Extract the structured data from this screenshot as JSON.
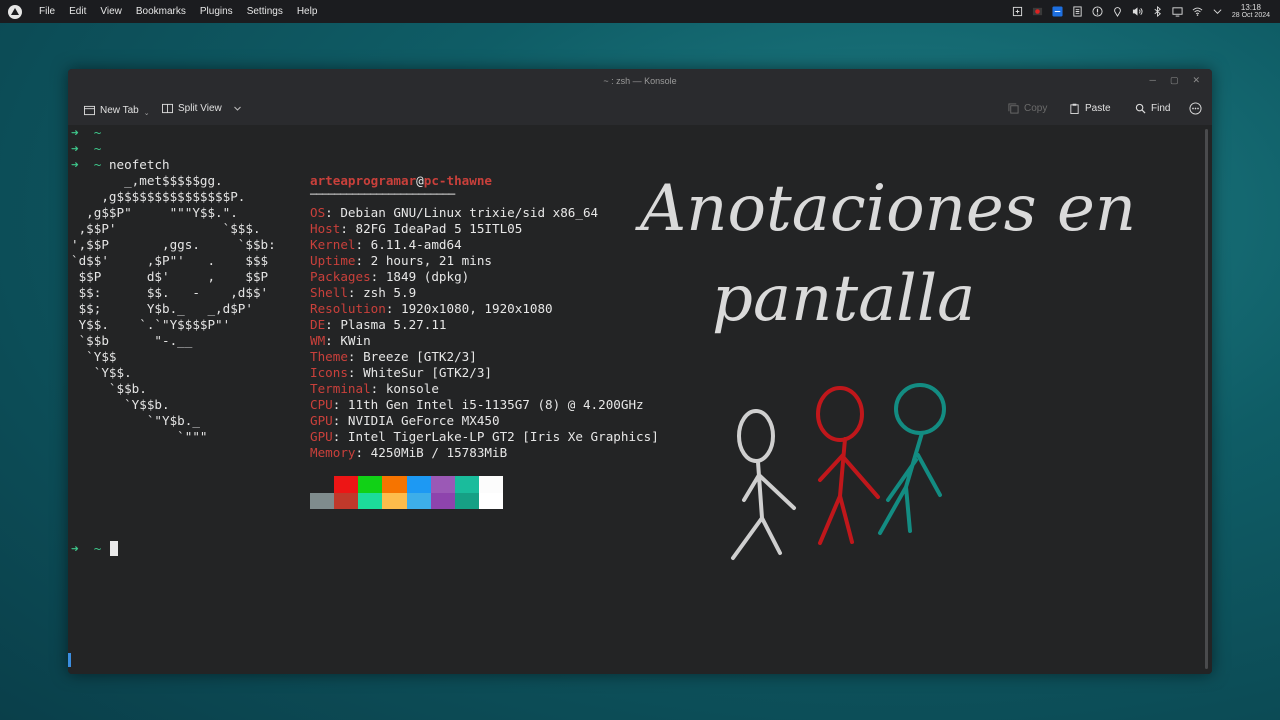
{
  "menubar": {
    "items": [
      "File",
      "Edit",
      "View",
      "Bookmarks",
      "Plugins",
      "Settings",
      "Help"
    ]
  },
  "tray": {
    "clock_time": "13:18",
    "clock_date": "28 Oct 2024",
    "icons": [
      "clipboard-icon",
      "record-icon",
      "app-icon",
      "notes-icon",
      "updates-icon",
      "location-icon",
      "volume-icon",
      "bluetooth-icon",
      "display-icon",
      "wifi-icon",
      "chevron-down-icon"
    ]
  },
  "window": {
    "title": "~ : zsh — Konsole",
    "toolbar": {
      "new_tab": "New Tab",
      "split_view": "Split View",
      "copy": "Copy",
      "paste": "Paste",
      "find": "Find"
    }
  },
  "terminal": {
    "prompt_arrow": "➜",
    "prompt_dir": "~",
    "command": "neofetch",
    "user": "arteaprogramar",
    "at": "@",
    "host": "pc-thawne",
    "separator": "────────────────────────",
    "logo_lines": [
      "       _,met$$$$$gg.",
      "    ,g$$$$$$$$$$$$$$$P.",
      "  ,g$$P\"     \"\"\"Y$$.\".",
      " ,$$P'              `$$$.",
      "',$$P       ,ggs.     `$$b:",
      "`d$$'     ,$P\"'   .    $$$",
      " $$P      d$'     ,    $$P",
      " $$:      $$.   -    ,d$$'",
      " $$;      Y$b._   _,d$P'",
      " Y$$.    `.`\"Y$$$$P\"'",
      " `$$b      \"-.__",
      "  `Y$$",
      "   `Y$$.",
      "     `$$b.",
      "       `Y$$b.",
      "          `\"Y$b._",
      "              `\"\"\""
    ],
    "info": [
      {
        "key": "OS",
        "value": "Debian GNU/Linux trixie/sid x86_64"
      },
      {
        "key": "Host",
        "value": "82FG IdeaPad 5 15ITL05"
      },
      {
        "key": "Kernel",
        "value": "6.11.4-amd64"
      },
      {
        "key": "Uptime",
        "value": "2 hours, 21 mins"
      },
      {
        "key": "Packages",
        "value": "1849 (dpkg)"
      },
      {
        "key": "Shell",
        "value": "zsh 5.9"
      },
      {
        "key": "Resolution",
        "value": "1920x1080, 1920x1080"
      },
      {
        "key": "DE",
        "value": "Plasma 5.27.11"
      },
      {
        "key": "WM",
        "value": "KWin"
      },
      {
        "key": "Theme",
        "value": "Breeze [GTK2/3]"
      },
      {
        "key": "Icons",
        "value": "WhiteSur [GTK2/3]"
      },
      {
        "key": "Terminal",
        "value": "konsole"
      },
      {
        "key": "CPU",
        "value": "11th Gen Intel i5-1135G7 (8) @ 4.200GHz"
      },
      {
        "key": "GPU",
        "value": "NVIDIA GeForce MX450"
      },
      {
        "key": "GPU",
        "value": "Intel TigerLake-LP GT2 [Iris Xe Graphics]"
      },
      {
        "key": "Memory",
        "value": "4250MiB / 15783MiB"
      }
    ],
    "palette_top": [
      "#232425",
      "#ed1515",
      "#11d116",
      "#f67400",
      "#1d99f3",
      "#9b59b6",
      "#1abc9c",
      "#fcfcfc"
    ],
    "palette_bottom": [
      "#7f8c8d",
      "#c0392b",
      "#1cdc9a",
      "#fdbc4b",
      "#3daee9",
      "#8e44ad",
      "#16a085",
      "#ffffff"
    ]
  },
  "annotation": {
    "line1": "Anotaciones en",
    "line2": "pantalla",
    "colors": [
      "#cfcfcf",
      "#c0171b",
      "#138c82"
    ]
  }
}
